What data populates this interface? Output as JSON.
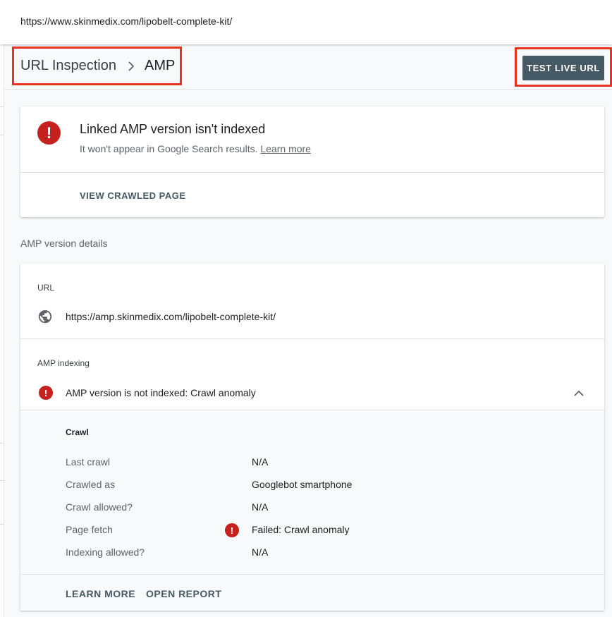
{
  "topbar": {
    "inspected_url": "https://www.skinmedix.com/lipobelt-complete-kit/"
  },
  "breadcrumb": {
    "root": "URL Inspection",
    "current": "AMP"
  },
  "header": {
    "test_live_url_label": "TEST LIVE URL"
  },
  "status_card": {
    "title": "Linked AMP version isn't indexed",
    "subtitle": "It won't appear in Google Search results.",
    "learn_more_link": "Learn more",
    "view_crawled_page_label": "VIEW CRAWLED PAGE"
  },
  "section_label": "AMP version details",
  "details_card": {
    "url_label": "URL",
    "amp_url": "https://amp.skinmedix.com/lipobelt-complete-kit/",
    "amp_indexing_label": "AMP indexing",
    "amp_indexing_status": "AMP version is not indexed: Crawl anomaly",
    "crawl": {
      "heading": "Crawl",
      "rows": [
        {
          "label": "Last crawl",
          "value": "N/A",
          "error": false
        },
        {
          "label": "Crawled as",
          "value": "Googlebot smartphone",
          "error": false
        },
        {
          "label": "Crawl allowed?",
          "value": "N/A",
          "error": false
        },
        {
          "label": "Page fetch",
          "value": "Failed: Crawl anomaly",
          "error": true
        },
        {
          "label": "Indexing allowed?",
          "value": "N/A",
          "error": false
        }
      ]
    },
    "learn_more_label": "LEARN MORE",
    "open_report_label": "OPEN REPORT"
  },
  "icons": {
    "error": "error-icon",
    "globe": "globe-icon",
    "chevron_right": "chevron-right-icon",
    "chevron_up": "chevron-up-icon"
  },
  "colors": {
    "error_red": "#c5221f",
    "annotation_red": "#e8341c",
    "button_slate": "#455a64"
  }
}
